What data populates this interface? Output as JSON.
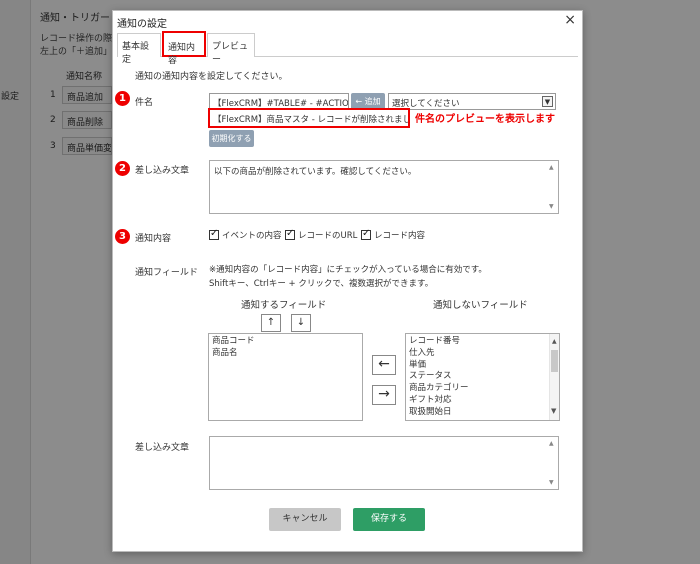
{
  "background": {
    "title": "通知・トリガー",
    "desc_line1": "レコード操作の際に",
    "desc_line2": "左上の「＋追加」ボ",
    "side_label": "設定",
    "table_header": "通知名称",
    "rows": [
      {
        "num": "1",
        "name": "商品追加"
      },
      {
        "num": "2",
        "name": "商品削除"
      },
      {
        "num": "3",
        "name": "商品単価変更"
      }
    ]
  },
  "modal": {
    "title": "通知の設定",
    "close_symbol": "×",
    "tabs": [
      {
        "label": "基本設定"
      },
      {
        "label": "通知内容"
      },
      {
        "label": "プレビュー"
      }
    ],
    "intro": "通知の通知内容を設定してください。",
    "badges": [
      "1",
      "2",
      "3"
    ],
    "subject": {
      "label": "件名",
      "value": "【FlexCRM】#TABLE# - #ACTION",
      "add_label": "← 追加",
      "select_value": "選択してください",
      "preview": "【FlexCRM】商品マスタ - レコードが削除されました",
      "preview_note": "件名のプレビューを表示します",
      "init_label": "初期化する"
    },
    "insert_text": {
      "label": "差し込み文章",
      "value": "以下の商品が削除されています。確認してください。"
    },
    "content": {
      "label": "通知内容",
      "options": [
        {
          "label": "イベントの内容"
        },
        {
          "label": "レコードのURL"
        },
        {
          "label": "レコード内容"
        }
      ]
    },
    "fields": {
      "label": "通知フィールド",
      "note1": "※通知内容の「レコード内容」にチェックが入っている場合に有効です。",
      "note2": "Shiftキー、Ctrlキー + クリックで、複数選択ができます。",
      "notify_heading": "通知するフィールド",
      "nonotify_heading": "通知しないフィールド",
      "up_symbol": "↑",
      "down_symbol": "↓",
      "move_left": "←",
      "move_right": "→",
      "notify_items": [
        "商品コード",
        "商品名"
      ],
      "nonotify_items": [
        "レコード番号",
        "仕入先",
        "単価",
        "ステータス",
        "商品カテゴリー",
        "ギフト対応",
        "取扱開始日"
      ]
    },
    "insert_text2": {
      "label": "差し込み文章",
      "value": ""
    },
    "cancel_label": "キャンセル",
    "save_label": "保存する"
  },
  "colors": {
    "highlight": "#ee0000",
    "save": "#2e9e65",
    "secondary_button": "#8fa0b2"
  }
}
